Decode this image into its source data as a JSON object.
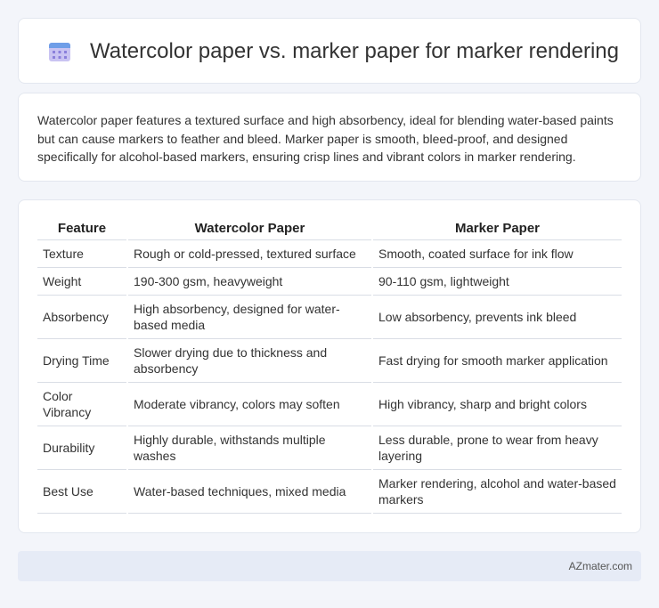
{
  "header": {
    "title": "Watercolor paper vs. marker paper for marker rendering",
    "icon": "calendar-icon",
    "icon_color": "#7b6fd6"
  },
  "description": "Watercolor paper features a textured surface and high absorbency, ideal for blending water-based paints but can cause markers to feather and bleed. Marker paper is smooth, bleed-proof, and designed specifically for alcohol-based markers, ensuring crisp lines and vibrant colors in marker rendering.",
  "table": {
    "headers": [
      "Feature",
      "Watercolor Paper",
      "Marker Paper"
    ],
    "rows": [
      [
        "Texture",
        "Rough or cold-pressed, textured surface",
        "Smooth, coated surface for ink flow"
      ],
      [
        "Weight",
        "190-300 gsm, heavyweight",
        "90-110 gsm, lightweight"
      ],
      [
        "Absorbency",
        "High absorbency, designed for water-based media",
        "Low absorbency, prevents ink bleed"
      ],
      [
        "Drying Time",
        "Slower drying due to thickness and absorbency",
        "Fast drying for smooth marker application"
      ],
      [
        "Color Vibrancy",
        "Moderate vibrancy, colors may soften",
        "High vibrancy, sharp and bright colors"
      ],
      [
        "Durability",
        "Highly durable, withstands multiple washes",
        "Less durable, prone to wear from heavy layering"
      ],
      [
        "Best Use",
        "Water-based techniques, mixed media",
        "Marker rendering, alcohol and water-based markers"
      ]
    ]
  },
  "footer": {
    "brand": "AZmater.com"
  }
}
